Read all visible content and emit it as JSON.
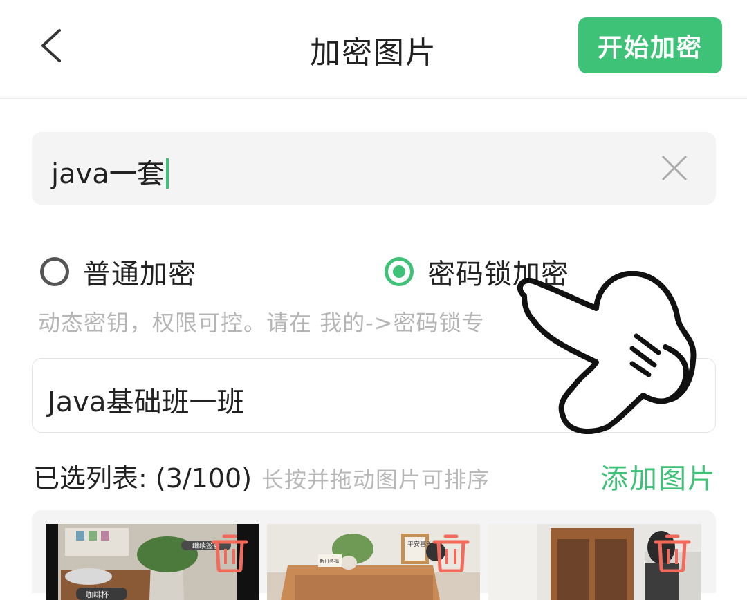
{
  "header": {
    "title": "加密图片",
    "start_button": "开始加密"
  },
  "input": {
    "value": "java一套"
  },
  "radio": [
    {
      "label": "普通加密",
      "selected": false
    },
    {
      "label": "密码锁加密",
      "selected": true
    }
  ],
  "hint": "动态密钥，权限可控。请在 我的->密码锁专",
  "group": {
    "value": "Java基础班一班"
  },
  "list": {
    "label": "已选列表: (3/100)",
    "sub": "长按并拖动图片可排序",
    "add": "添加图片"
  },
  "thumbnails": [
    {
      "overlay_tag": "继续签署",
      "caption": "咖啡杯"
    },
    {
      "sign": "平安喜乐",
      "label": "新日冬福"
    },
    {}
  ],
  "colors": {
    "accent": "#3ec277",
    "delete": "#f26a5b"
  }
}
